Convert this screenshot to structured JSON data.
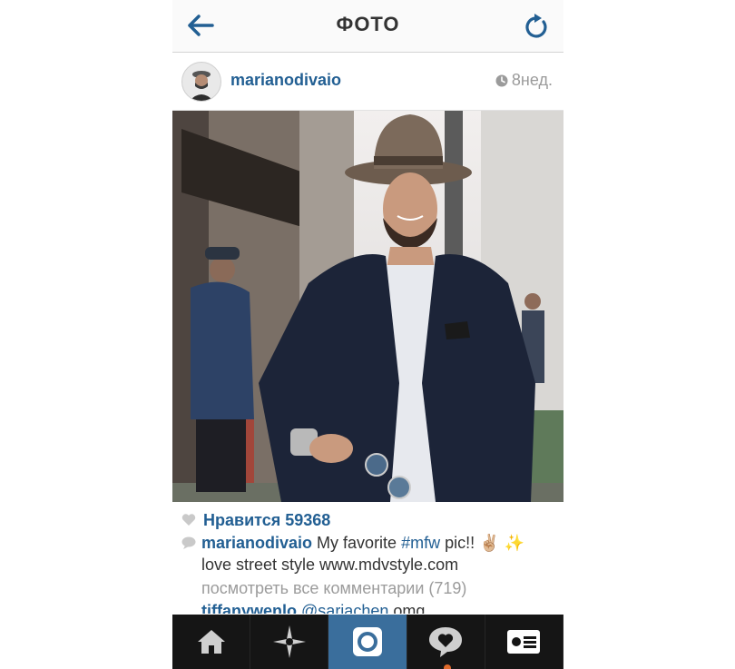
{
  "header": {
    "title": "ФОТО",
    "back_icon": "arrow-left-icon",
    "refresh_icon": "refresh-icon"
  },
  "post": {
    "username": "marianodivaio",
    "time": "8нед.",
    "likes_label": "Нравится 59368",
    "caption_user": "marianodivaio",
    "caption_text_1": " My favorite ",
    "caption_tag": "#mfw",
    "caption_text_2": " pic!! ✌🏼 ✨",
    "caption_line2": "love street style www.mdvstyle.com",
    "view_all_comments": "посмотреть все комментарии (719)",
    "comment_user": "tiffanywenlo",
    "comment_mention": "@sariachen",
    "comment_text": " omg"
  },
  "tabs": [
    {
      "name": "home",
      "icon": "home-icon"
    },
    {
      "name": "explore",
      "icon": "explore-star-icon"
    },
    {
      "name": "camera",
      "icon": "camera-icon",
      "active": true
    },
    {
      "name": "activity",
      "icon": "activity-heart-bubble-icon"
    },
    {
      "name": "profile",
      "icon": "profile-card-icon"
    }
  ],
  "colors": {
    "accent": "#225f93",
    "tabbar_bg": "#151515",
    "active_tab": "#3a6e9c",
    "notification_dot": "#e06a2b"
  }
}
